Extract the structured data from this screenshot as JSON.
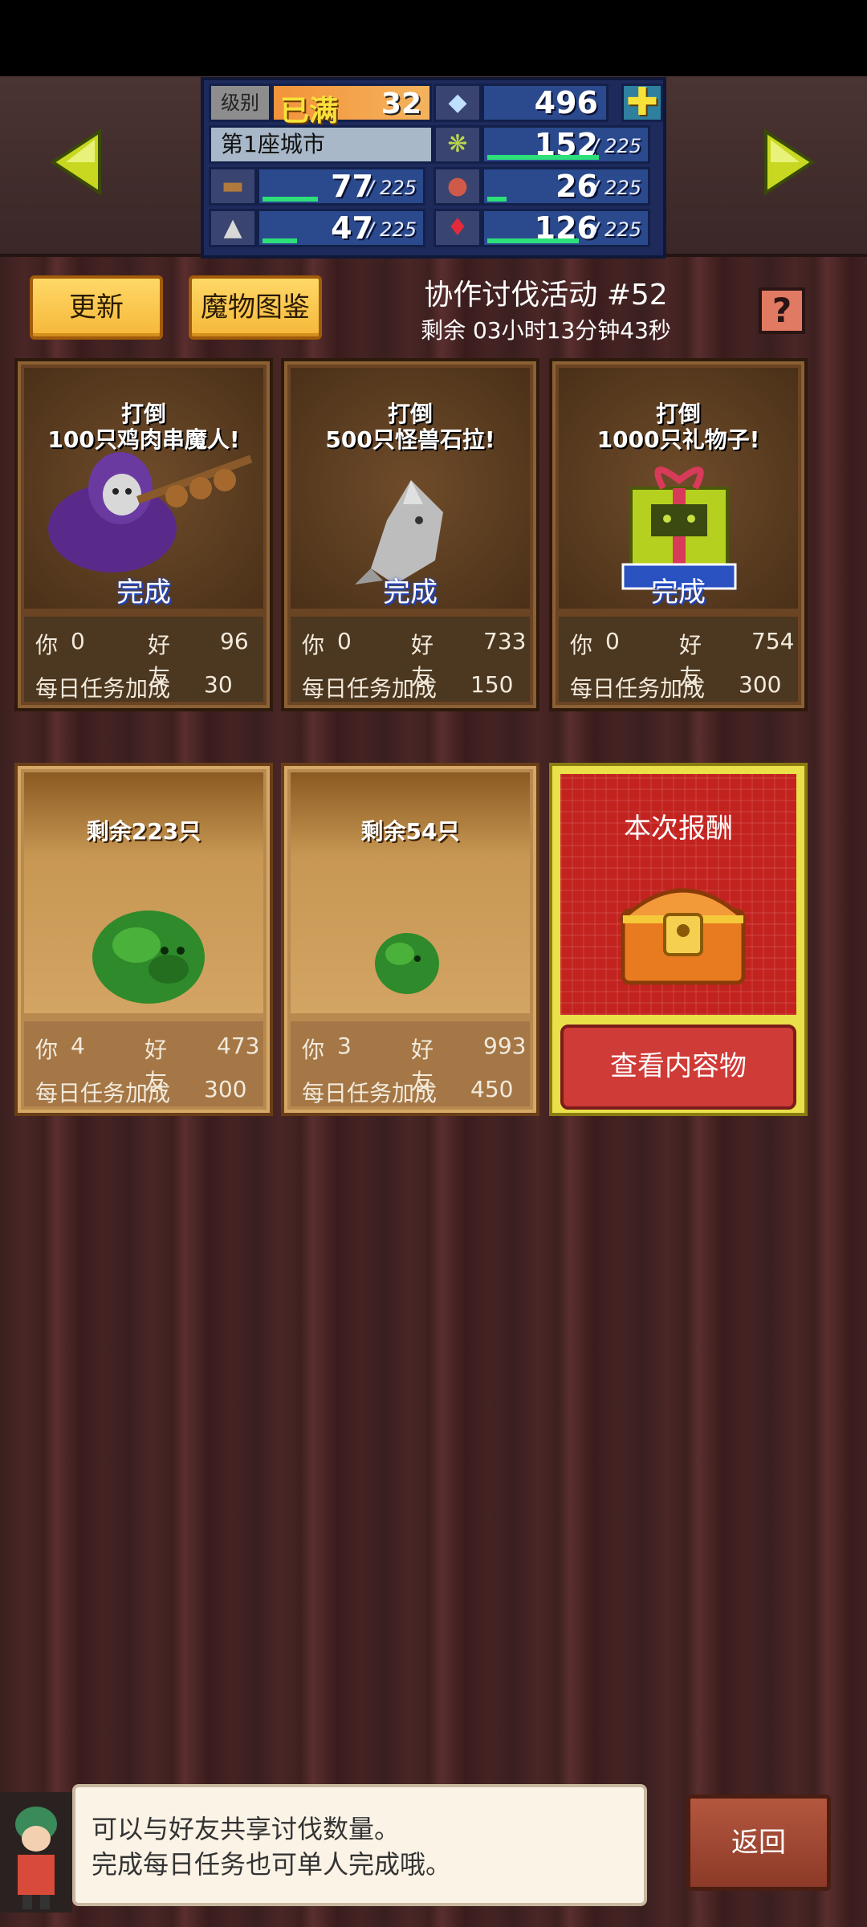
{
  "hud": {
    "level_label": "级别",
    "level_max_label": "已满",
    "level": "32",
    "gems": "496",
    "plus_symbol": "✚",
    "city_name": "第1座城市",
    "resources": [
      {
        "icon": "wheat-icon",
        "value": "152",
        "max": "/ 225",
        "fill": 0.68
      },
      {
        "icon": "wood-icon",
        "value": "77",
        "max": "/ 225",
        "fill": 0.34
      },
      {
        "icon": "food-icon",
        "value": "26",
        "max": "/ 225",
        "fill": 0.12
      },
      {
        "icon": "ore-icon",
        "value": "47",
        "max": "/ 225",
        "fill": 0.21
      },
      {
        "icon": "ruby-icon",
        "value": "126",
        "max": "/ 225",
        "fill": 0.56
      }
    ]
  },
  "toolbar": {
    "update_label": "更新",
    "monster_book_label": "魔物图鉴",
    "help_symbol": "?"
  },
  "event": {
    "title": "协作讨伐活动 #52",
    "remaining": "剩余 03小时13分钟43秒"
  },
  "cards": [
    {
      "line1": "打倒",
      "line2": "100只鸡肉串魔人!",
      "status": "完成",
      "you_label": "你",
      "you": "0",
      "friend_label": "好友",
      "friend": "96",
      "bonus_label": "每日任务加成",
      "bonus": "30"
    },
    {
      "line1": "打倒",
      "line2": "500只怪兽石拉!",
      "status": "完成",
      "you_label": "你",
      "you": "0",
      "friend_label": "好友",
      "friend": "733",
      "bonus_label": "每日任务加成",
      "bonus": "150"
    },
    {
      "line1": "打倒",
      "line2": "1000只礼物子!",
      "status": "完成",
      "you_label": "你",
      "you": "0",
      "friend_label": "好友",
      "friend": "754",
      "bonus_label": "每日任务加成",
      "bonus": "300"
    },
    {
      "remaining": "剩余223只",
      "you_label": "你",
      "you": "4",
      "friend_label": "好友",
      "friend": "473",
      "bonus_label": "每日任务加成",
      "bonus": "300"
    },
    {
      "remaining": "剩余54只",
      "you_label": "你",
      "you": "3",
      "friend_label": "好友",
      "friend": "993",
      "bonus_label": "每日任务加成",
      "bonus": "450"
    }
  ],
  "reward": {
    "title": "本次报酬",
    "view_label": "查看内容物"
  },
  "dialog": {
    "line1": "可以与好友共享讨伐数量。",
    "line2": "完成每日任务也可单人完成哦。"
  },
  "back_label": "返回",
  "colors": {
    "accent_gold": "#f5b73a",
    "reward_red": "#c3231f",
    "done_blue": "#1d3fb0"
  }
}
